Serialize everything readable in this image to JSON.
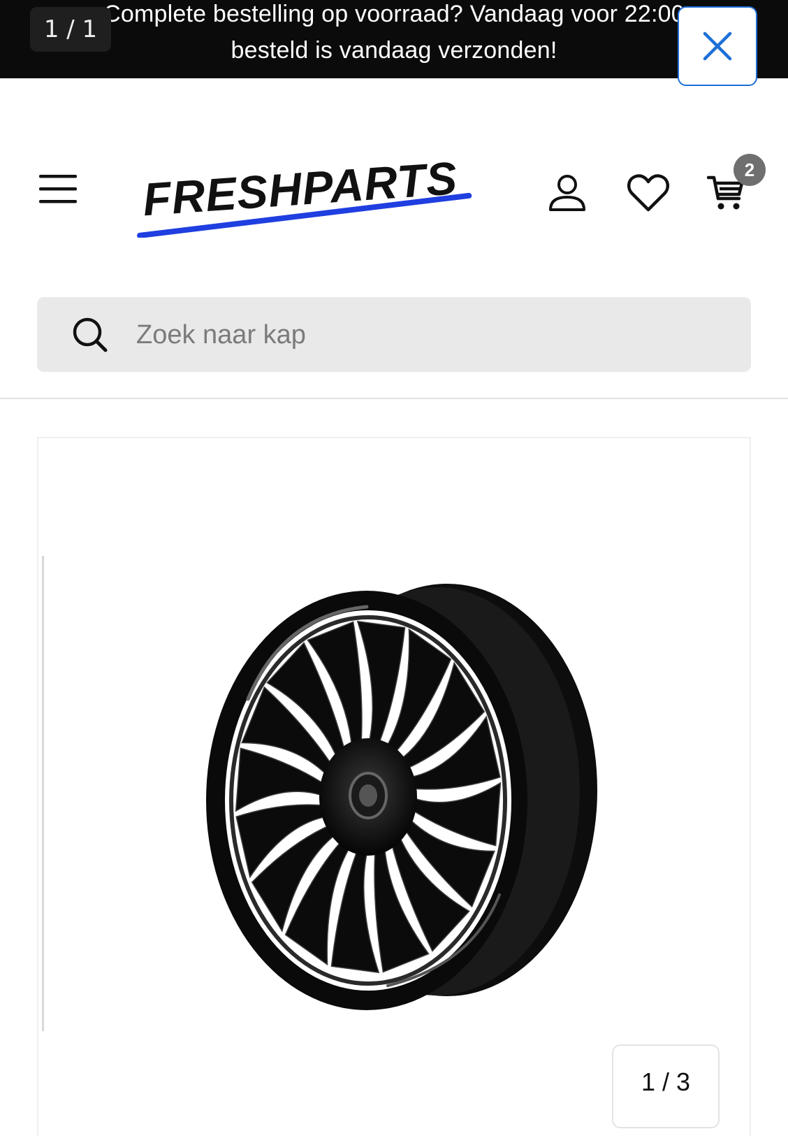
{
  "announcement": {
    "line1": "Complete bestelling op voorraad? Vandaag voor 22:00",
    "line2": "besteld is vandaag verzonden!",
    "counter": "1 / 1",
    "close_icon": "close-icon"
  },
  "header": {
    "logo_text": "FRESHPARTS",
    "logo_underline_color": "#1f3fe0",
    "menu_icon": "hamburger-icon",
    "account_icon": "user-icon",
    "wishlist_icon": "heart-icon",
    "cart_icon": "cart-icon",
    "cart_count": "2"
  },
  "search": {
    "placeholder": "Zoek naar kap",
    "value": ""
  },
  "gallery": {
    "image_label": "black scooter wheel rim",
    "page_indicator": "1 / 3"
  }
}
